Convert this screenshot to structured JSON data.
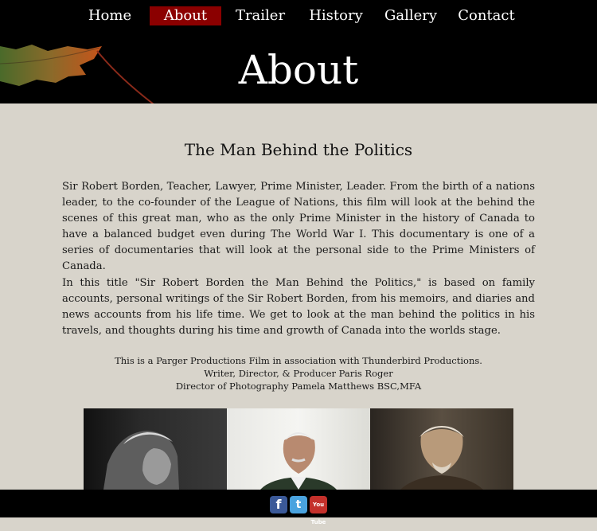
{
  "nav": {
    "items": [
      {
        "label": "Home"
      },
      {
        "label": "About",
        "active": true
      },
      {
        "label": "Trailer"
      },
      {
        "label": "History"
      },
      {
        "label": "Gallery"
      },
      {
        "label": "Contact"
      }
    ]
  },
  "header": {
    "title": "About"
  },
  "main": {
    "subtitle": "The Man Behind the Politics",
    "paragraph1": "Sir Robert Borden, Teacher, Lawyer, Prime Minister, Leader. From the birth of a nations leader, to the co-founder of the League of Nations, this film will look at the behind the scenes of this great man, who as the only Prime Minister in the history of Canada to have a balanced budget even during The World War I. This documentary is one of a series of documentaries that will look at the personal side to the Prime Ministers of Canada.",
    "paragraph2": "In this title \"Sir Robert Borden the Man Behind the Politics,\" is based on family accounts, personal writings of the Sir Robert Borden, from his memoirs, and diaries and news accounts from his life time. We get to look at the man behind the politics in his travels, and thoughts during his time and growth of Canada into the worlds stage.",
    "credits": [
      "This is a Parger Productions Film in association with Thunderbird Productions.",
      "Writer, Director, & Producer Paris Roger",
      "Director of Photography Pamela Matthews BSC,MFA"
    ]
  },
  "footer": {
    "social": [
      {
        "icon": "facebook-icon",
        "glyph": "f"
      },
      {
        "icon": "twitter-icon",
        "glyph": "t"
      },
      {
        "icon": "youtube-icon",
        "glyph": "You Tube"
      }
    ]
  },
  "colors": {
    "background": "#d8d4cb",
    "header": "#000000",
    "active_nav": "#8b0000"
  }
}
